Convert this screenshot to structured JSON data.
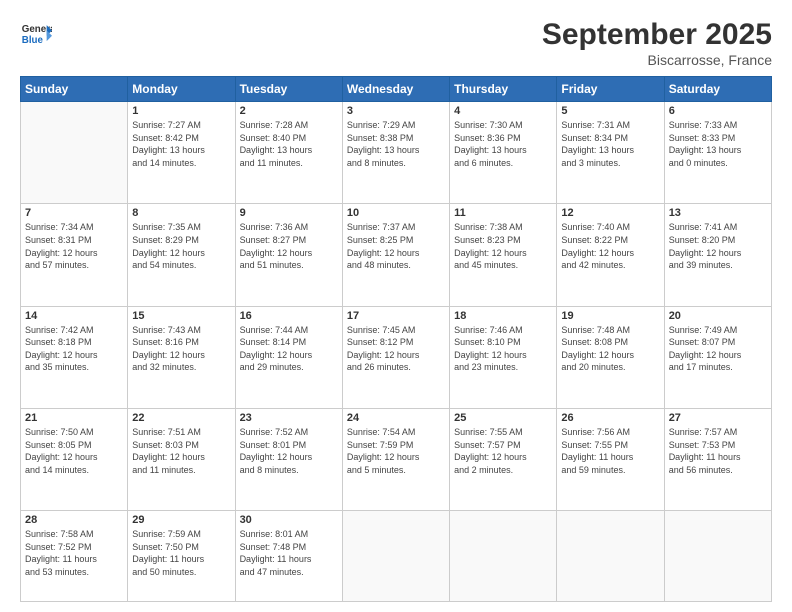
{
  "header": {
    "logo_line1": "General",
    "logo_line2": "Blue",
    "month": "September 2025",
    "location": "Biscarrosse, France"
  },
  "weekdays": [
    "Sunday",
    "Monday",
    "Tuesday",
    "Wednesday",
    "Thursday",
    "Friday",
    "Saturday"
  ],
  "weeks": [
    [
      {
        "day": "",
        "info": ""
      },
      {
        "day": "1",
        "info": "Sunrise: 7:27 AM\nSunset: 8:42 PM\nDaylight: 13 hours\nand 14 minutes."
      },
      {
        "day": "2",
        "info": "Sunrise: 7:28 AM\nSunset: 8:40 PM\nDaylight: 13 hours\nand 11 minutes."
      },
      {
        "day": "3",
        "info": "Sunrise: 7:29 AM\nSunset: 8:38 PM\nDaylight: 13 hours\nand 8 minutes."
      },
      {
        "day": "4",
        "info": "Sunrise: 7:30 AM\nSunset: 8:36 PM\nDaylight: 13 hours\nand 6 minutes."
      },
      {
        "day": "5",
        "info": "Sunrise: 7:31 AM\nSunset: 8:34 PM\nDaylight: 13 hours\nand 3 minutes."
      },
      {
        "day": "6",
        "info": "Sunrise: 7:33 AM\nSunset: 8:33 PM\nDaylight: 13 hours\nand 0 minutes."
      }
    ],
    [
      {
        "day": "7",
        "info": "Sunrise: 7:34 AM\nSunset: 8:31 PM\nDaylight: 12 hours\nand 57 minutes."
      },
      {
        "day": "8",
        "info": "Sunrise: 7:35 AM\nSunset: 8:29 PM\nDaylight: 12 hours\nand 54 minutes."
      },
      {
        "day": "9",
        "info": "Sunrise: 7:36 AM\nSunset: 8:27 PM\nDaylight: 12 hours\nand 51 minutes."
      },
      {
        "day": "10",
        "info": "Sunrise: 7:37 AM\nSunset: 8:25 PM\nDaylight: 12 hours\nand 48 minutes."
      },
      {
        "day": "11",
        "info": "Sunrise: 7:38 AM\nSunset: 8:23 PM\nDaylight: 12 hours\nand 45 minutes."
      },
      {
        "day": "12",
        "info": "Sunrise: 7:40 AM\nSunset: 8:22 PM\nDaylight: 12 hours\nand 42 minutes."
      },
      {
        "day": "13",
        "info": "Sunrise: 7:41 AM\nSunset: 8:20 PM\nDaylight: 12 hours\nand 39 minutes."
      }
    ],
    [
      {
        "day": "14",
        "info": "Sunrise: 7:42 AM\nSunset: 8:18 PM\nDaylight: 12 hours\nand 35 minutes."
      },
      {
        "day": "15",
        "info": "Sunrise: 7:43 AM\nSunset: 8:16 PM\nDaylight: 12 hours\nand 32 minutes."
      },
      {
        "day": "16",
        "info": "Sunrise: 7:44 AM\nSunset: 8:14 PM\nDaylight: 12 hours\nand 29 minutes."
      },
      {
        "day": "17",
        "info": "Sunrise: 7:45 AM\nSunset: 8:12 PM\nDaylight: 12 hours\nand 26 minutes."
      },
      {
        "day": "18",
        "info": "Sunrise: 7:46 AM\nSunset: 8:10 PM\nDaylight: 12 hours\nand 23 minutes."
      },
      {
        "day": "19",
        "info": "Sunrise: 7:48 AM\nSunset: 8:08 PM\nDaylight: 12 hours\nand 20 minutes."
      },
      {
        "day": "20",
        "info": "Sunrise: 7:49 AM\nSunset: 8:07 PM\nDaylight: 12 hours\nand 17 minutes."
      }
    ],
    [
      {
        "day": "21",
        "info": "Sunrise: 7:50 AM\nSunset: 8:05 PM\nDaylight: 12 hours\nand 14 minutes."
      },
      {
        "day": "22",
        "info": "Sunrise: 7:51 AM\nSunset: 8:03 PM\nDaylight: 12 hours\nand 11 minutes."
      },
      {
        "day": "23",
        "info": "Sunrise: 7:52 AM\nSunset: 8:01 PM\nDaylight: 12 hours\nand 8 minutes."
      },
      {
        "day": "24",
        "info": "Sunrise: 7:54 AM\nSunset: 7:59 PM\nDaylight: 12 hours\nand 5 minutes."
      },
      {
        "day": "25",
        "info": "Sunrise: 7:55 AM\nSunset: 7:57 PM\nDaylight: 12 hours\nand 2 minutes."
      },
      {
        "day": "26",
        "info": "Sunrise: 7:56 AM\nSunset: 7:55 PM\nDaylight: 11 hours\nand 59 minutes."
      },
      {
        "day": "27",
        "info": "Sunrise: 7:57 AM\nSunset: 7:53 PM\nDaylight: 11 hours\nand 56 minutes."
      }
    ],
    [
      {
        "day": "28",
        "info": "Sunrise: 7:58 AM\nSunset: 7:52 PM\nDaylight: 11 hours\nand 53 minutes."
      },
      {
        "day": "29",
        "info": "Sunrise: 7:59 AM\nSunset: 7:50 PM\nDaylight: 11 hours\nand 50 minutes."
      },
      {
        "day": "30",
        "info": "Sunrise: 8:01 AM\nSunset: 7:48 PM\nDaylight: 11 hours\nand 47 minutes."
      },
      {
        "day": "",
        "info": ""
      },
      {
        "day": "",
        "info": ""
      },
      {
        "day": "",
        "info": ""
      },
      {
        "day": "",
        "info": ""
      }
    ]
  ]
}
